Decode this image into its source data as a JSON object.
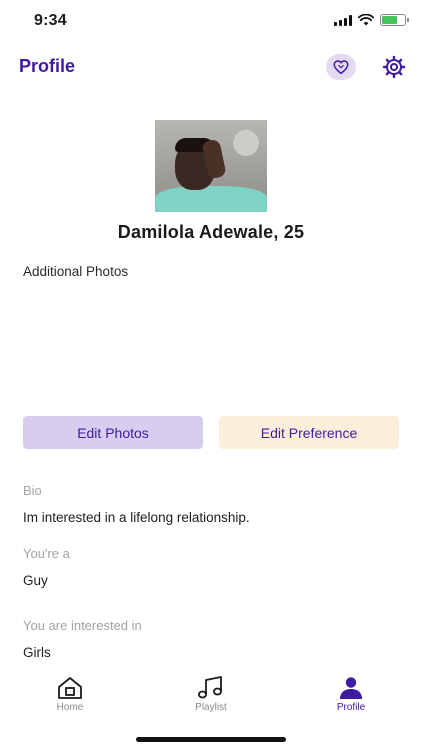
{
  "status_bar": {
    "time": "9:34"
  },
  "header": {
    "title": "Profile"
  },
  "profile": {
    "name_age": "Damilola Adewale, 25"
  },
  "sections": {
    "additional_photos_label": "Additional Photos"
  },
  "actions": {
    "edit_photos": "Edit Photos",
    "edit_preference": "Edit Preference"
  },
  "fields": {
    "bio_label": "Bio",
    "bio_value": "Im interested in a lifelong relationship.",
    "youre_a_label": "You're a",
    "youre_a_value": "Guy",
    "interested_label": "You are interested in",
    "interested_value": "Girls"
  },
  "tabbar": {
    "home": "Home",
    "playlist": "Playlist",
    "profile": "Profile",
    "active": "profile"
  },
  "colors": {
    "brand": "#3f1aa3",
    "edit_photos_bg": "#d8cdef",
    "edit_preference_bg": "#fbefdc"
  },
  "icons": {
    "likes": "heart-icon",
    "settings": "gear-icon",
    "home": "home-icon",
    "playlist": "music-note-icon",
    "profile": "person-icon"
  }
}
